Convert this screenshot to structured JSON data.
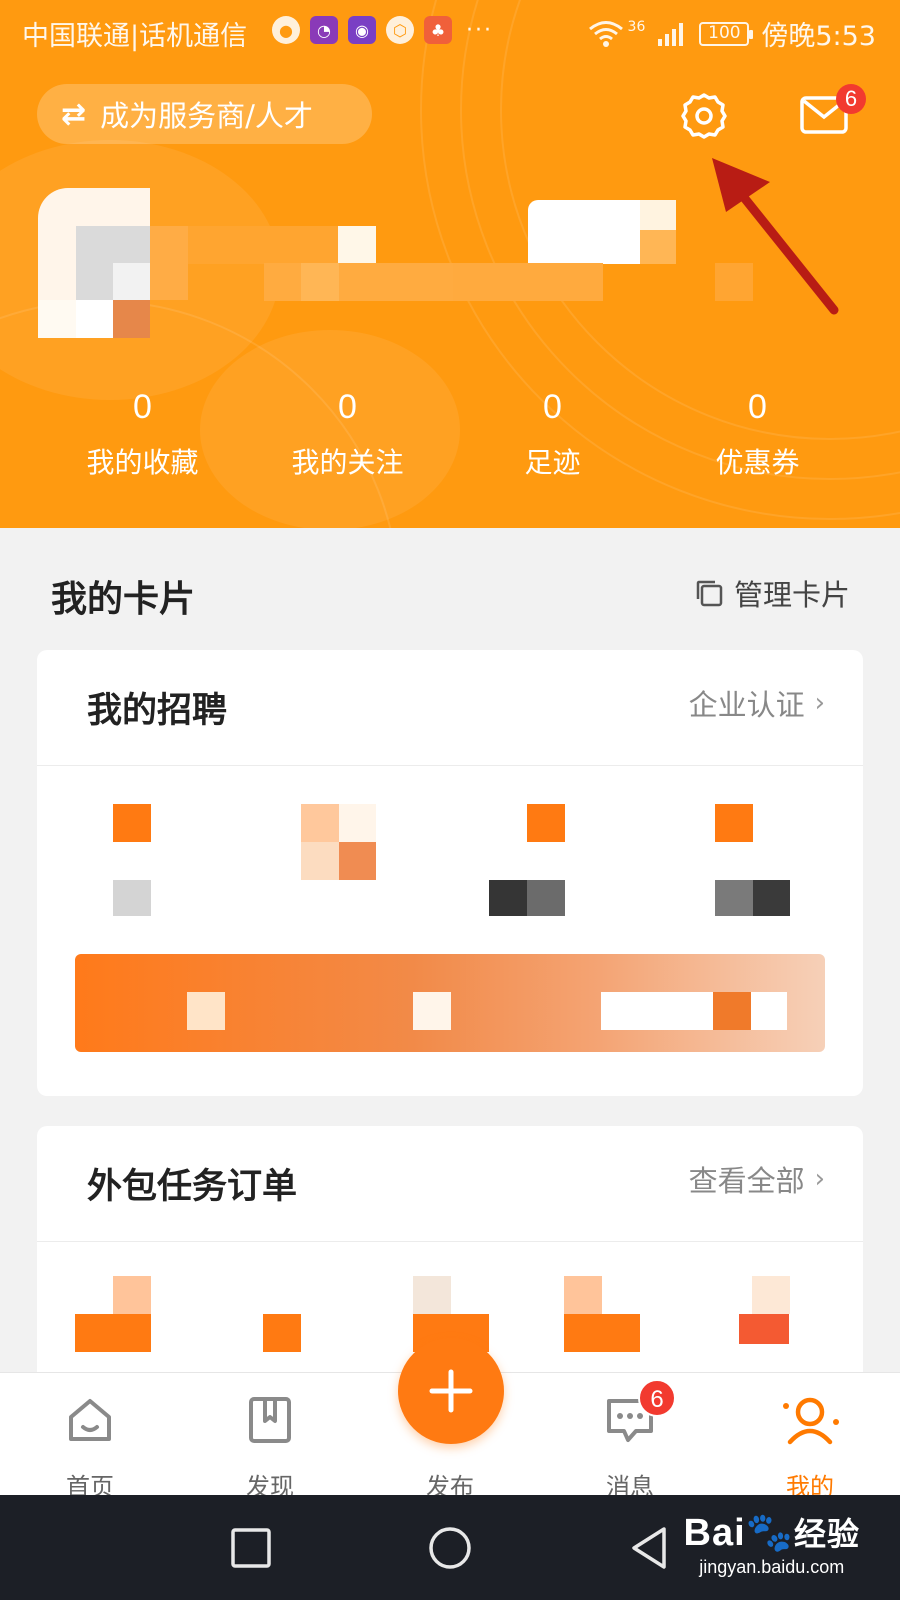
{
  "status_bar": {
    "carrier": "中国联通|话机通信",
    "network": "36",
    "battery": "100",
    "time": "傍晚5:53"
  },
  "header": {
    "switch_role_label": "成为服务商/人才",
    "mail_badge": "6",
    "stats": [
      {
        "value": "0",
        "label": "我的收藏"
      },
      {
        "value": "0",
        "label": "我的关注"
      },
      {
        "value": "0",
        "label": "足迹"
      },
      {
        "value": "0",
        "label": "优惠券"
      }
    ]
  },
  "cards_section": {
    "title": "我的卡片",
    "manage_label": "管理卡片"
  },
  "recruit_card": {
    "title": "我的招聘",
    "link": "企业认证"
  },
  "task_card": {
    "title": "外包任务订单",
    "link": "查看全部"
  },
  "tabbar": {
    "items": [
      {
        "label": "首页",
        "icon": "home-icon"
      },
      {
        "label": "发现",
        "icon": "bookmark-icon"
      },
      {
        "label": "发布",
        "icon": "plus-icon"
      },
      {
        "label": "消息",
        "icon": "chat-icon"
      },
      {
        "label": "我的",
        "icon": "person-icon"
      }
    ],
    "message_badge": "6",
    "active": "我的"
  },
  "watermark": {
    "main": "Bai",
    "suffix": "经验",
    "sub": "jingyan.baidu.com"
  },
  "colors": {
    "header_bg": "#ff9a10",
    "accent": "#ff7a00",
    "badge": "#f23a2f",
    "arrow": "#b81c14"
  }
}
